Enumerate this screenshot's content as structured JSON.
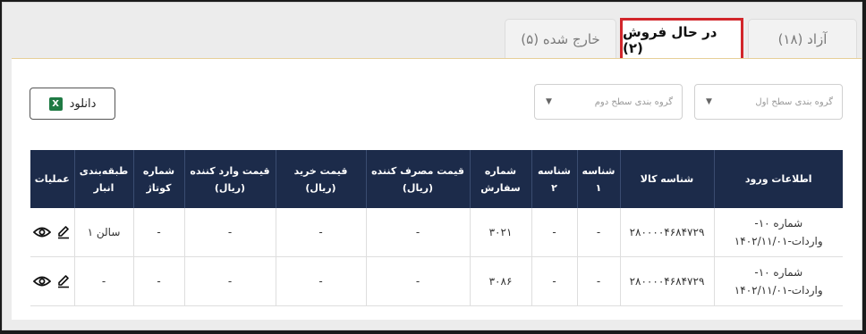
{
  "tabs": [
    {
      "label": "آزاد (۱۸)",
      "active": false
    },
    {
      "label": "در حال فروش (۲)",
      "active": true
    },
    {
      "label": "خارج شده (۵)",
      "active": false
    }
  ],
  "filters": {
    "level1": {
      "placeholder": "گروه بندی سطح اول"
    },
    "level2": {
      "placeholder": "گروه بندی سطح دوم"
    }
  },
  "download": {
    "label": "دانلود",
    "icon": "excel-icon"
  },
  "table": {
    "headers": {
      "entry_info": "اطلاعات ورود",
      "product_id": "شناسه کالا",
      "id1": "شناسه ۱",
      "id2": "شناسه ۲",
      "order_no": "شماره سفارش",
      "consumer_price": "قیمت مصرف کننده (ریال)",
      "purchase_price": "قیمت خرید (ریال)",
      "importer_price": "قیمت وارد کننده (ریال)",
      "cotage_no": "شماره کوتاژ",
      "warehouse_class": "طبقه‌بندی انبار",
      "operations": "عملیات"
    },
    "rows": [
      {
        "entry_line1": "شماره ۱۰-",
        "entry_line2": "واردات-۱۴۰۲/۱۱/۰۱",
        "product_id": "۲۸۰۰۰۰۴۶۸۴۷۲۹",
        "id1": "-",
        "id2": "-",
        "order_no": "۳۰۲۱",
        "consumer_price": "-",
        "purchase_price": "-",
        "importer_price": "-",
        "cotage_no": "-",
        "warehouse_class": "سالن ۱"
      },
      {
        "entry_line1": "شماره ۱۰-",
        "entry_line2": "واردات-۱۴۰۲/۱۱/۰۱",
        "product_id": "۲۸۰۰۰۰۴۶۸۴۷۲۹",
        "id1": "-",
        "id2": "-",
        "order_no": "۳۰۸۶",
        "consumer_price": "-",
        "purchase_price": "-",
        "importer_price": "-",
        "cotage_no": "-",
        "warehouse_class": "-"
      }
    ]
  },
  "colors": {
    "header_bg": "#1c2b4a",
    "highlight": "#d2262b",
    "tab_accent": "#e6cf98",
    "excel": "#1f7a44"
  }
}
